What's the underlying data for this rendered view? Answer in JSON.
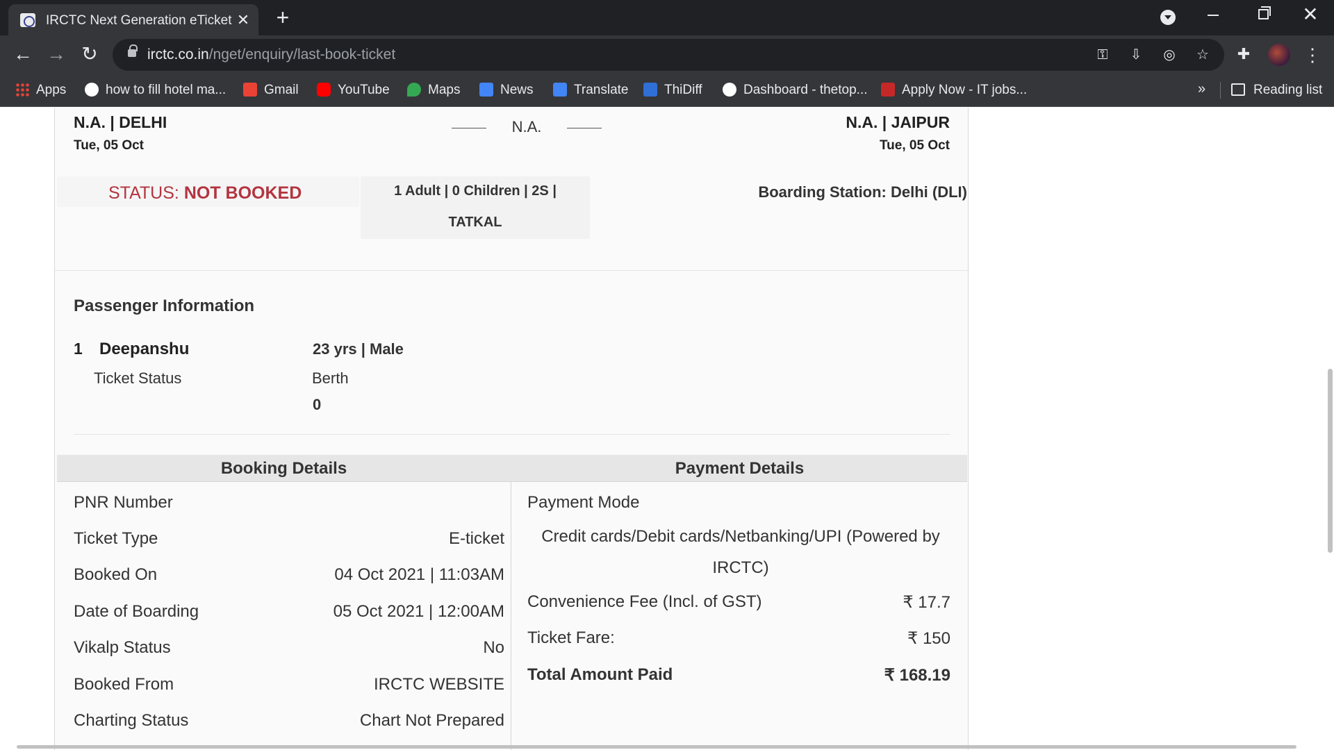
{
  "browser": {
    "tab_title": "IRCTC Next Generation eTicketing",
    "tab_close": "✕",
    "new_tab": "+",
    "url_host": "irctc.co.in",
    "url_path": "/nget/enquiry/last-book-ticket",
    "bookmarks": [
      {
        "label": "Apps",
        "icon": "apps-grid-icon"
      },
      {
        "label": "how to fill hotel ma...",
        "icon": "google-icon"
      },
      {
        "label": "Gmail",
        "icon": "gmail-icon"
      },
      {
        "label": "YouTube",
        "icon": "youtube-icon"
      },
      {
        "label": "Maps",
        "icon": "maps-icon"
      },
      {
        "label": "News",
        "icon": "news-icon"
      },
      {
        "label": "Translate",
        "icon": "translate-icon"
      },
      {
        "label": "ThiDiff",
        "icon": "thidiff-icon"
      },
      {
        "label": "Dashboard - thetop...",
        "icon": "dashboard-icon"
      },
      {
        "label": "Apply Now - IT jobs...",
        "icon": "jobs-icon"
      }
    ],
    "bookmarks_more": "»",
    "reading_list": "Reading list"
  },
  "journey": {
    "from": "N.A. | DELHI",
    "from_date": "Tue, 05 Oct",
    "middle": "N.A.",
    "to": "N.A. | JAIPUR",
    "to_date": "Tue, 05 Oct"
  },
  "status": {
    "prefix": "STATUS: ",
    "value": "NOT BOOKED",
    "pax_line1": "1 Adult | 0 Children | 2S |",
    "pax_line2": "TATKAL",
    "boarding": "Boarding Station: Delhi (DLI)"
  },
  "passenger": {
    "section_title": "Passenger Information",
    "number": "1",
    "name": "Deepanshu",
    "age_gender": "23 yrs | Male",
    "ticket_status_label": "Ticket Status",
    "berth_label": "Berth",
    "berth_value": "0"
  },
  "booking": {
    "title": "Booking Details",
    "rows": [
      {
        "label": "PNR Number",
        "value": ""
      },
      {
        "label": "Ticket Type",
        "value": "E-ticket"
      },
      {
        "label": "Booked On",
        "value": "04 Oct 2021 | 11:03AM"
      },
      {
        "label": "Date of Boarding",
        "value": "05 Oct 2021 | 12:00AM"
      },
      {
        "label": "Vikalp Status",
        "value": "No"
      },
      {
        "label": "Booked From",
        "value": "IRCTC WEBSITE"
      },
      {
        "label": "Charting Status",
        "value": "Chart Not Prepared"
      }
    ]
  },
  "payment": {
    "title": "Payment Details",
    "mode_label": "Payment Mode",
    "mode_value": "Credit cards/Debit cards/Netbanking/UPI (Powered by IRCTC)",
    "convenience_label": "Convenience Fee (Incl. of GST)",
    "convenience_value": "₹ 17.7",
    "fare_label": "Ticket Fare:",
    "fare_value": "₹ 150",
    "total_label": "Total Amount Paid",
    "total_value": "₹ 168.19"
  },
  "colors": {
    "status_red": "#b3343f",
    "chrome_dark": "#202124",
    "chrome_toolbar": "#35363a"
  }
}
